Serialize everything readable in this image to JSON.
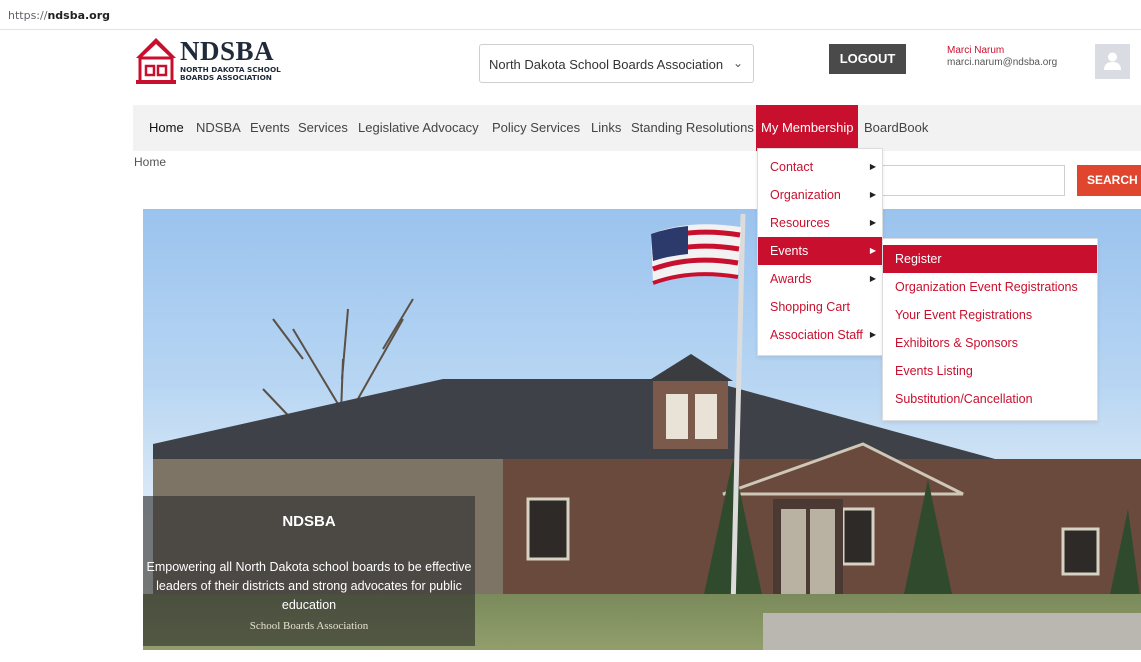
{
  "browser": {
    "url_prefix": "https://",
    "url_domain": "ndsba.org"
  },
  "logo": {
    "name": "NDSBA",
    "subtitle_line1": "NORTH DAKOTA SCHOOL",
    "subtitle_line2": "BOARDS ASSOCIATION"
  },
  "org_select": {
    "value": "North Dakota School Boards Association"
  },
  "header": {
    "logout_label": "LOGOUT",
    "user_name": "Marci Narum",
    "user_email": "marci.narum@ndsba.org"
  },
  "nav": {
    "items": [
      "Home",
      "NDSBA",
      "Events",
      "Services",
      "Legislative Advocacy",
      "Policy Services",
      "Links",
      "Standing Resolutions",
      "My Membership",
      "BoardBook"
    ]
  },
  "breadcrumb": "Home",
  "search": {
    "button_label": "SEARCH"
  },
  "membership_menu": [
    "Contact",
    "Organization",
    "Resources",
    "Events",
    "Awards",
    "Shopping Cart",
    "Association Staff"
  ],
  "events_submenu": [
    "Register",
    "Organization Event Registrations",
    "Your Event Registrations",
    "Exhibitors & Sponsors",
    "Events Listing",
    "Substitution/Cancellation"
  ],
  "hero": {
    "title": "NDSBA",
    "text": "Empowering all North Dakota school boards to be effective leaders of their districts and strong advocates for public education",
    "sign_text": "School Boards Association"
  },
  "colors": {
    "brand_red": "#c8102e",
    "search_orange": "#e0452e",
    "dark_button": "#4a4a4a"
  }
}
